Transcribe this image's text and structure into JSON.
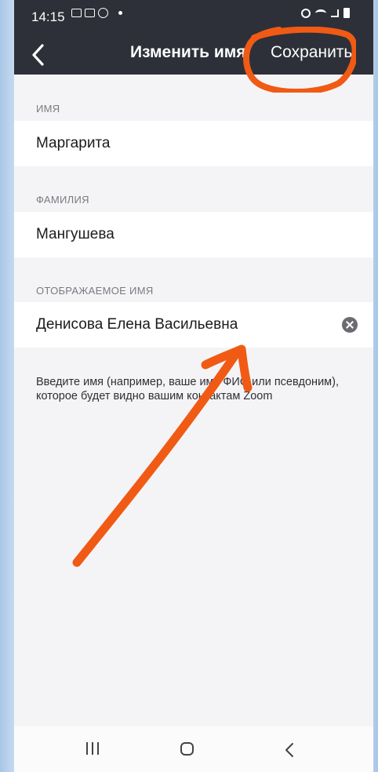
{
  "status_bar": {
    "time": "14:15"
  },
  "header": {
    "title": "Изменить имя",
    "save_label": "Сохранить"
  },
  "first_name": {
    "label": "ИМЯ",
    "value": "Маргарита"
  },
  "last_name": {
    "label": "ФАМИЛИЯ",
    "value": "Мангушева"
  },
  "display_name": {
    "label": "ОТОБРАЖАЕМОЕ ИМЯ",
    "value": "Денисова Елена Васильевна"
  },
  "hint": "Введите имя (например, ваше имя ФИО или псевдоним), которое будет видно вашим контактам Zoom",
  "colors": {
    "header_bg": "#2d3038",
    "annotation": "#f05a14",
    "page_bg": "#f4f4f6"
  },
  "icons": [
    "chevron-left-icon",
    "clear-icon",
    "recent-apps-icon",
    "home-icon",
    "nav-back-icon"
  ]
}
